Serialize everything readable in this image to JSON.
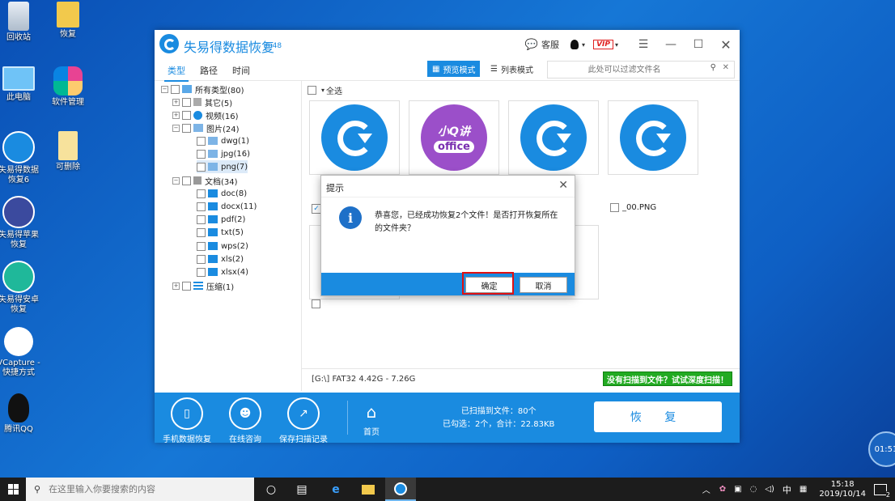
{
  "desktop": {
    "icons": [
      {
        "label": "回收站"
      },
      {
        "label": "恢复"
      },
      {
        "label": "此电脑"
      },
      {
        "label": "软件管理"
      },
      {
        "label": "失易得数据\n恢复6"
      },
      {
        "label": "可删除"
      },
      {
        "label": "失易得苹果\n恢复"
      },
      {
        "label": "失易得安卓\n恢复"
      },
      {
        "label": "VCapture -\n快捷方式"
      },
      {
        "label": "腾讯QQ"
      }
    ]
  },
  "app": {
    "title": "失易得数据恢复",
    "version": "6.48",
    "service_label": "客服",
    "vip_label": "VIP",
    "left_tabs": [
      "类型",
      "路径",
      "时间"
    ],
    "view_modes": {
      "preview": "预览模式",
      "list": "列表模式"
    },
    "search_placeholder": "此处可以过滤文件名",
    "select_all": "全选",
    "tree": {
      "root": "所有类型(80)",
      "items": [
        {
          "label": "其它(5)"
        },
        {
          "label": "视频(16)"
        },
        {
          "label": "图片(24)"
        },
        {
          "label": "dwg(1)"
        },
        {
          "label": "jpg(16)"
        },
        {
          "label": "png(7)"
        },
        {
          "label": "文档(34)"
        },
        {
          "label": "doc(8)"
        },
        {
          "label": "docx(11)"
        },
        {
          "label": "pdf(2)"
        },
        {
          "label": "txt(5)"
        },
        {
          "label": "wps(2)"
        },
        {
          "label": "xls(2)"
        },
        {
          "label": "xlsx(4)"
        },
        {
          "label": "压缩(1)"
        }
      ]
    },
    "thumbs": {
      "office_line1": "小Q讲",
      "office_line2": "office",
      "file4_name": "_00.PNG"
    },
    "status": {
      "disk_info": "[G:\\] FAT32 4.42G - 7.26G",
      "deep_scan": "没有扫描到文件？试试深度扫描！",
      "scanned": "已扫描到文件：80个",
      "selected": "已勾选：2个，合计：22.83KB"
    },
    "bottom_actions": [
      "手机数据恢复",
      "在线咨询",
      "保存扫描记录",
      "首页"
    ],
    "restore_label": "恢 复"
  },
  "dialog": {
    "title": "提示",
    "message": "恭喜您，已经成功恢复2个文件！是否打开恢复所在的文件夹？",
    "ok_label": "确定",
    "cancel_label": "取消"
  },
  "taskbar": {
    "search_placeholder": "在这里输入你要搜索的内容",
    "ime": "中",
    "time": "15:18",
    "date": "2019/10/14",
    "notifications": "2"
  },
  "overlay_timer": "01:51"
}
